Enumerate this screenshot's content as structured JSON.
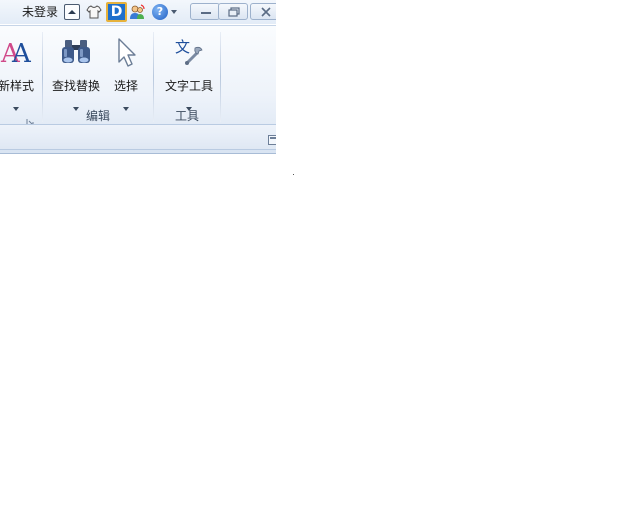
{
  "title_bar": {
    "login_status": "未登录",
    "icons": [
      "caret-up-icon",
      "skin-icon",
      "d-logo-icon",
      "users-icon",
      "help-icon",
      "chevron-down-icon"
    ],
    "d_logo_text": "D",
    "help_text": "?"
  },
  "window_controls": [
    "minimize-button",
    "restore-button",
    "close-button"
  ],
  "ribbon": {
    "groups": [
      {
        "label": "",
        "buttons": [
          {
            "label": "新样式",
            "icon": "font-style-icon",
            "has_dropdown": true
          }
        ],
        "has_launcher": true
      },
      {
        "label": "编辑",
        "buttons": [
          {
            "label": "查找替换",
            "icon": "binoculars-icon",
            "has_dropdown": true
          },
          {
            "label": "选择",
            "icon": "cursor-arrow-icon",
            "has_dropdown": true
          }
        ]
      },
      {
        "label": "工具",
        "buttons": [
          {
            "label": "文字工具",
            "icon": "text-tools-icon",
            "has_dropdown": true
          }
        ]
      }
    ]
  },
  "colors": {
    "ribbon_top": "#fafcfe",
    "ribbon_bottom": "#e3ebf6",
    "border": "#b9cbe2",
    "accent_blue": "#1d6fcc",
    "logo_border": "#e6b23c"
  }
}
